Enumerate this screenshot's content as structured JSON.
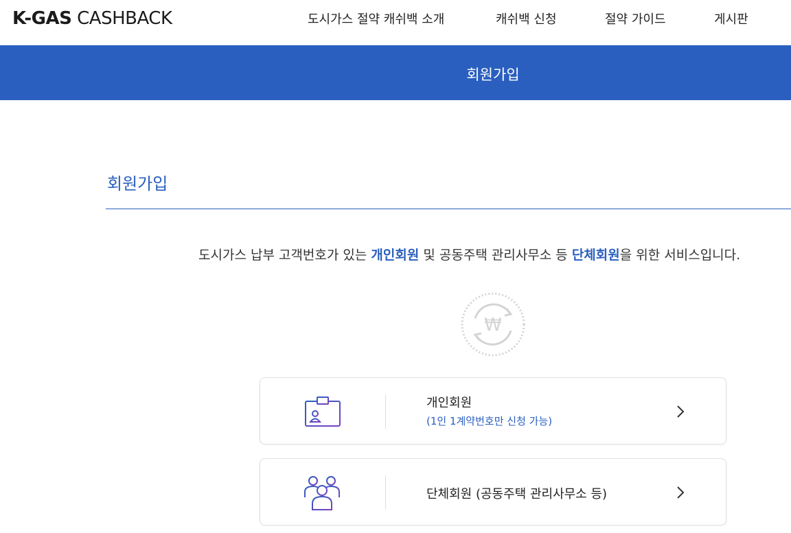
{
  "header": {
    "logo_bold": "K-GAS",
    "logo_light": " CASHBACK",
    "nav": [
      {
        "label": "도시가스 절약 캐쉬백 소개"
      },
      {
        "label": "캐쉬백 신청"
      },
      {
        "label": "절약 가이드"
      },
      {
        "label": "게시판"
      }
    ]
  },
  "banner": {
    "title": "회원가입"
  },
  "section": {
    "title": "회원가입"
  },
  "intro": {
    "part1": "도시가스 납부 고객번호가 있는 ",
    "hl1": "개인회원",
    "part2": " 및 공동주택 관리사무소 등 ",
    "hl2": "단체회원",
    "part3": "을 위한 서비스입니다."
  },
  "won_symbol": "₩",
  "cards": [
    {
      "label": "개인회원",
      "sub": "(1인 1계약번호만 신청 가능)",
      "icon": "id-card-icon"
    },
    {
      "label": "단체회원 (공동주택 관리사무소 등)",
      "icon": "group-users-icon"
    }
  ],
  "colors": {
    "accent": "#2a5fbf",
    "icon_gradient_start": "#2a5fbf",
    "icon_gradient_end": "#7a3fc0"
  }
}
